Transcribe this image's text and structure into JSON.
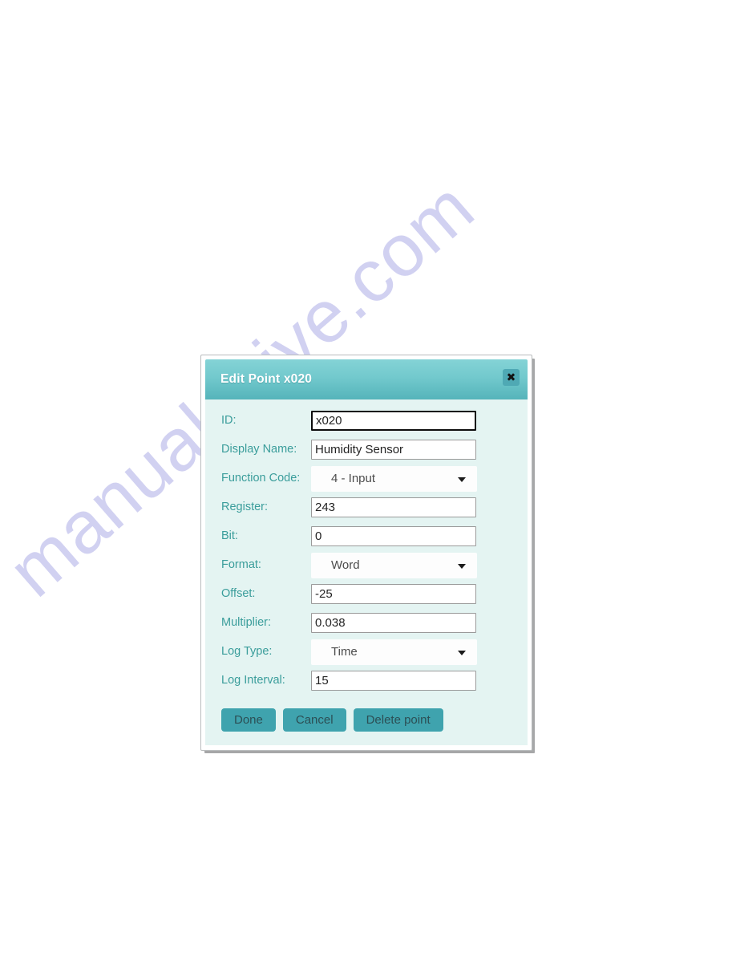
{
  "page": {
    "watermark": "manualshive.com",
    "background_color": "#ffffff"
  },
  "dialog": {
    "title": "Edit Point x020",
    "close_icon": "close-icon",
    "accent_color": "#3fa3ae",
    "header_color": "#72c9cd",
    "body_color": "#e4f4f2",
    "label_color": "#3a9d9b",
    "fields": [
      {
        "label": "ID:",
        "type": "text",
        "value": "x020",
        "focused": true,
        "name": "id"
      },
      {
        "label": "Display Name:",
        "type": "text",
        "value": "Humidity Sensor",
        "focused": false,
        "name": "display-name"
      },
      {
        "label": "Function Code:",
        "type": "select",
        "value": "4 - Input",
        "focused": false,
        "name": "function-code"
      },
      {
        "label": "Register:",
        "type": "text",
        "value": "243",
        "focused": false,
        "name": "register"
      },
      {
        "label": "Bit:",
        "type": "text",
        "value": "0",
        "focused": false,
        "name": "bit"
      },
      {
        "label": "Format:",
        "type": "select",
        "value": "Word",
        "focused": false,
        "name": "format"
      },
      {
        "label": "Offset:",
        "type": "text",
        "value": "-25",
        "focused": false,
        "name": "offset"
      },
      {
        "label": "Multiplier:",
        "type": "text",
        "value": "0.038",
        "focused": false,
        "name": "multiplier"
      },
      {
        "label": "Log Type:",
        "type": "select",
        "value": "Time",
        "focused": false,
        "name": "log-type"
      },
      {
        "label": "Log Interval:",
        "type": "text",
        "value": "15",
        "focused": false,
        "name": "log-interval"
      }
    ],
    "buttons": [
      {
        "label": "Done",
        "name": "done"
      },
      {
        "label": "Cancel",
        "name": "cancel"
      },
      {
        "label": "Delete point",
        "name": "delete-point"
      }
    ]
  }
}
